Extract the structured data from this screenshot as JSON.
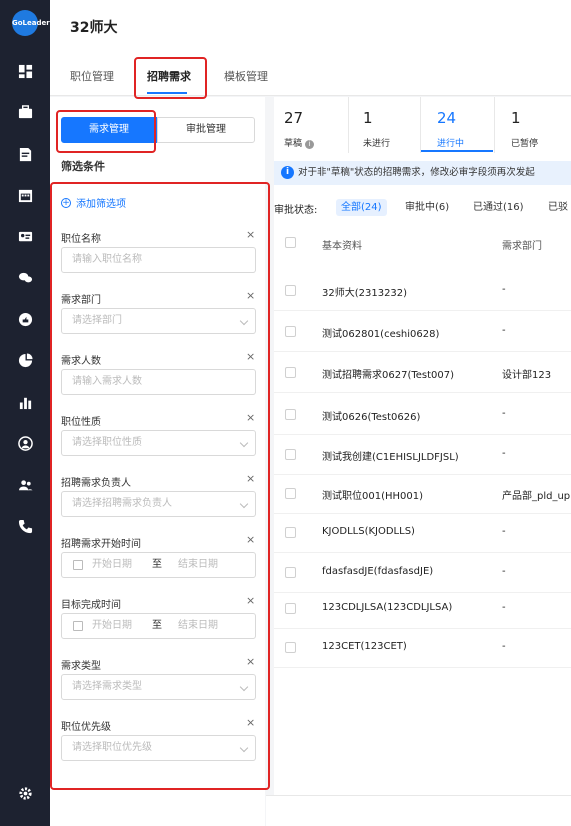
{
  "app": {
    "logo_text": "GoLeader",
    "title": "32师大"
  },
  "sidebar": {
    "icons": [
      "dashboard-icon",
      "briefcase-icon",
      "document-icon",
      "calendar-icon",
      "id-card-icon",
      "chat-icon",
      "thumbs-up-icon",
      "pie-chart-icon",
      "bar-chart-icon",
      "user-circle-icon",
      "users-icon",
      "phone-icon",
      "settings-icon"
    ]
  },
  "tabs": [
    {
      "label": "职位管理"
    },
    {
      "label": "招聘需求"
    },
    {
      "label": "模板管理"
    }
  ],
  "segment": {
    "left": "需求管理",
    "right": "审批管理"
  },
  "filter": {
    "title": "筛选条件",
    "add_label": "添加筛选项",
    "fields": [
      {
        "label": "职位名称",
        "placeholder": "请输入职位名称",
        "type": "input"
      },
      {
        "label": "需求部门",
        "placeholder": "请选择部门",
        "type": "select"
      },
      {
        "label": "需求人数",
        "placeholder": "请输入需求人数",
        "type": "input"
      },
      {
        "label": "职位性质",
        "placeholder": "请选择职位性质",
        "type": "select"
      },
      {
        "label": "招聘需求负责人",
        "placeholder": "请选择招聘需求负责人",
        "type": "select"
      },
      {
        "label": "招聘需求开始时间",
        "start": "开始日期",
        "sep": "至",
        "end": "结束日期",
        "type": "range"
      },
      {
        "label": "目标完成时间",
        "start": "开始日期",
        "sep": "至",
        "end": "结束日期",
        "type": "range"
      },
      {
        "label": "需求类型",
        "placeholder": "请选择需求类型",
        "type": "select"
      },
      {
        "label": "职位优先级",
        "placeholder": "请选择职位优先级",
        "type": "select"
      }
    ]
  },
  "stats": [
    {
      "num": "27",
      "label": "草稿"
    },
    {
      "num": "1",
      "label": "未进行"
    },
    {
      "num": "24",
      "label": "进行中"
    },
    {
      "num": "1",
      "label": "已暂停"
    }
  ],
  "info_text": "对于非\"草稿\"状态的招聘需求，修改必审字段须再次发起",
  "approval": {
    "label": "审批状态:",
    "chips": [
      "全部(24)",
      "审批中(6)",
      "已通过(16)",
      "已驳"
    ]
  },
  "table": {
    "headers": [
      "基本资料",
      "需求部门"
    ],
    "rows": [
      {
        "name": "32师大(2313232)",
        "dept": "-"
      },
      {
        "name": "测试062801(ceshi0628)",
        "dept": "-"
      },
      {
        "name": "测试招聘需求0627(Test007)",
        "dept": "设计部123"
      },
      {
        "name": "测试0626(Test0626)",
        "dept": "-"
      },
      {
        "name": "测试我创建(C1EHISLJLDFJSL)",
        "dept": "-"
      },
      {
        "name": "测试职位001(HH001)",
        "dept": "产品部_pld_up"
      },
      {
        "name": "KJODLLS(KJODLLS)",
        "dept": "-"
      },
      {
        "name": "fdasfasdJE(fdasfasdJE)",
        "dept": "-"
      },
      {
        "name": "123CDLJLSA(123CDLJLSA)",
        "dept": "-"
      },
      {
        "name": "123CET(123CET)",
        "dept": "-"
      }
    ]
  }
}
